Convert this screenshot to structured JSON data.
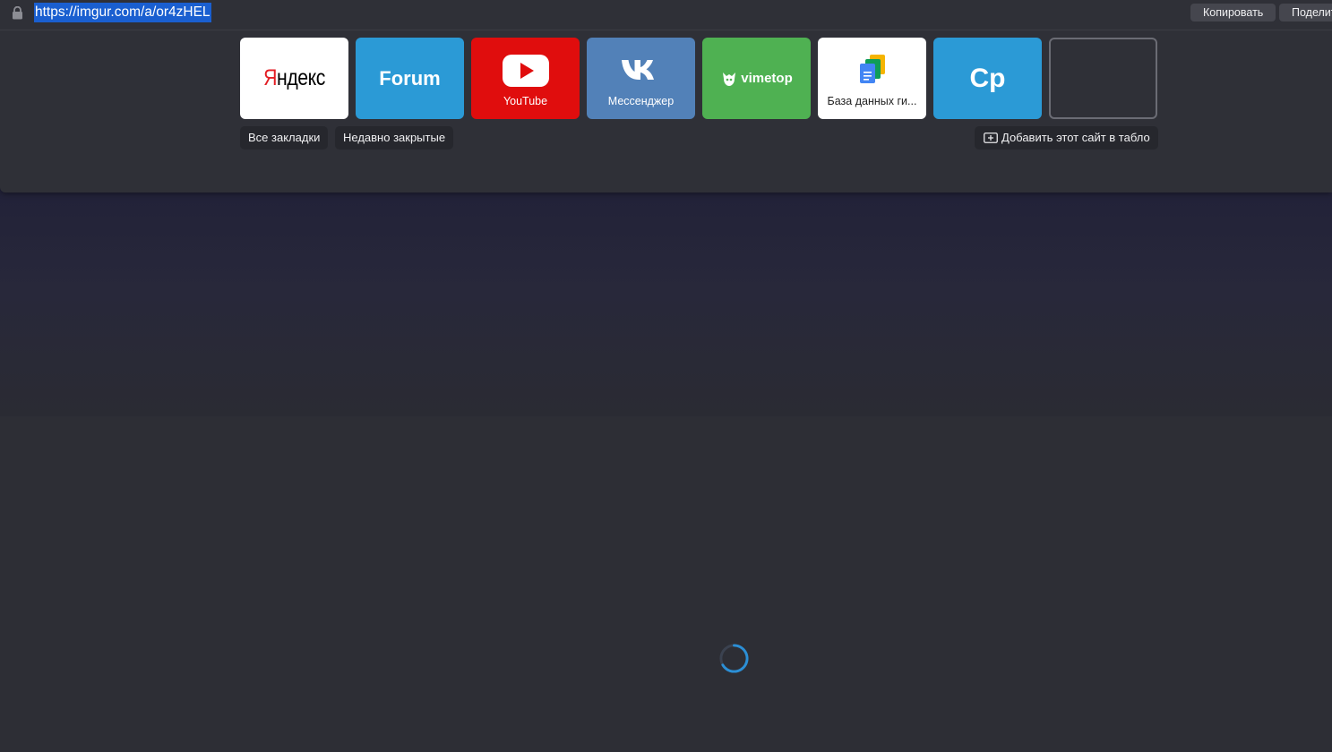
{
  "url": "https://imgur.com/a/or4zHEL",
  "url_bar": {
    "copy_label": "Копировать",
    "share_label": "Поделиться"
  },
  "tiles": [
    {
      "title": "Яндекс",
      "label": ""
    },
    {
      "title": "Forum",
      "label": ""
    },
    {
      "title": "",
      "label": "YouTube"
    },
    {
      "title": "",
      "label": "Мессенджер"
    },
    {
      "title": "vimetop",
      "label": ""
    },
    {
      "title": "",
      "label": "База данных ги..."
    },
    {
      "title": "Cp",
      "label": ""
    },
    {
      "title": "",
      "label": ""
    }
  ],
  "actions": {
    "all_bookmarks": "Все закладки",
    "recently_closed": "Недавно закрытые",
    "add_site": "Добавить этот сайт в табло"
  },
  "icons": {
    "lock": "lock-icon",
    "youtube": "youtube-logo-icon",
    "vk": "vk-logo-icon",
    "vimetop": "vimetop-logo-icon",
    "gdocs": "google-docs-icon",
    "add": "add-to-board-icon",
    "spinner": "loading-spinner-icon"
  },
  "colors": {
    "url_selection": "#1a5fd0",
    "youtube": "#e00d0d",
    "vk": "#5281b8",
    "vimetop": "#4fb152",
    "forum": "#2b9ad6",
    "spinner": "#2b8fd6"
  }
}
